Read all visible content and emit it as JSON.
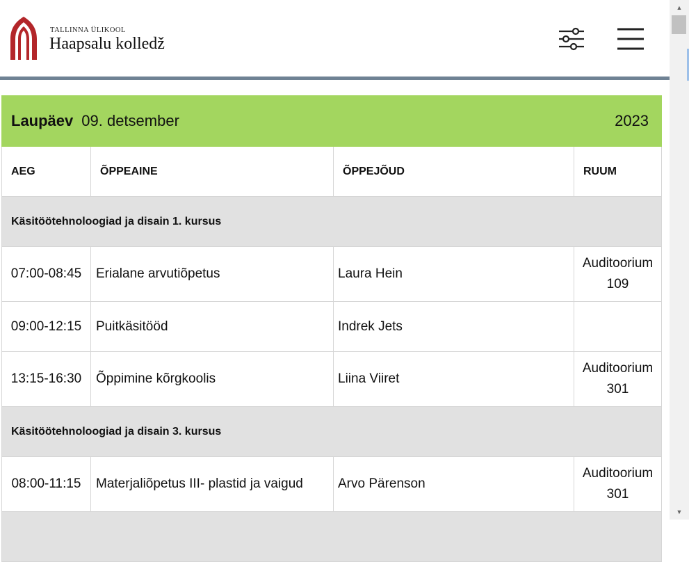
{
  "header": {
    "brand_small": "TALLINNA ÜLIKOOL",
    "brand_large": "Haapsalu kolledž",
    "logo_color": "#b3262a",
    "filter_icon": "sliders-icon",
    "menu_icon": "hamburger-menu-icon"
  },
  "day": {
    "weekday": "Laupäev",
    "date": "09. detsember",
    "year": "2023",
    "accent_color": "#a3d65f"
  },
  "columns": {
    "time": "AEG",
    "subject": "ÕPPEAINE",
    "teacher": "ÕPPEJÕUD",
    "room": "RUUM"
  },
  "groups": [
    {
      "title": "Käsitöötehnoloogiad ja disain 1. kursus",
      "lessons": [
        {
          "time": "07:00-08:45",
          "subject": "Erialane arvutiõpetus",
          "teacher": "Laura Hein",
          "room_line1": "Auditoorium",
          "room_line2": "109"
        },
        {
          "time": "09:00-12:15",
          "subject": "Puitkäsitööd",
          "teacher": "Indrek Jets",
          "room_line1": "",
          "room_line2": ""
        },
        {
          "time": "13:15-16:30",
          "subject": "Õppimine kõrgkoolis",
          "teacher": "Liina Viiret",
          "room_line1": "Auditoorium",
          "room_line2": "301"
        }
      ]
    },
    {
      "title": "Käsitöötehnoloogiad ja disain 3. kursus",
      "lessons": [
        {
          "time": "08:00-11:15",
          "subject": "Materjaliõpetus III- plastid ja vaigud",
          "teacher": "Arvo Pärenson",
          "room_line1": "Auditoorium",
          "room_line2": "301"
        }
      ]
    }
  ]
}
